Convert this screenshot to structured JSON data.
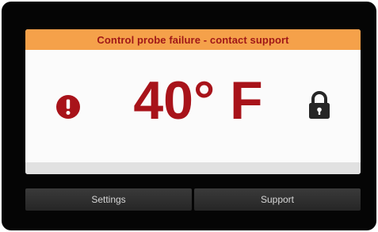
{
  "alert": {
    "message": "Control probe failure - contact support",
    "color": "#f5a14a",
    "text_color": "#a01818"
  },
  "reading": {
    "temperature": "40° F",
    "color": "#a8131a",
    "status_icon": "exclamation-circle-icon",
    "lock_icon": "lock-icon"
  },
  "buttons": {
    "settings_label": "Settings",
    "support_label": "Support"
  }
}
